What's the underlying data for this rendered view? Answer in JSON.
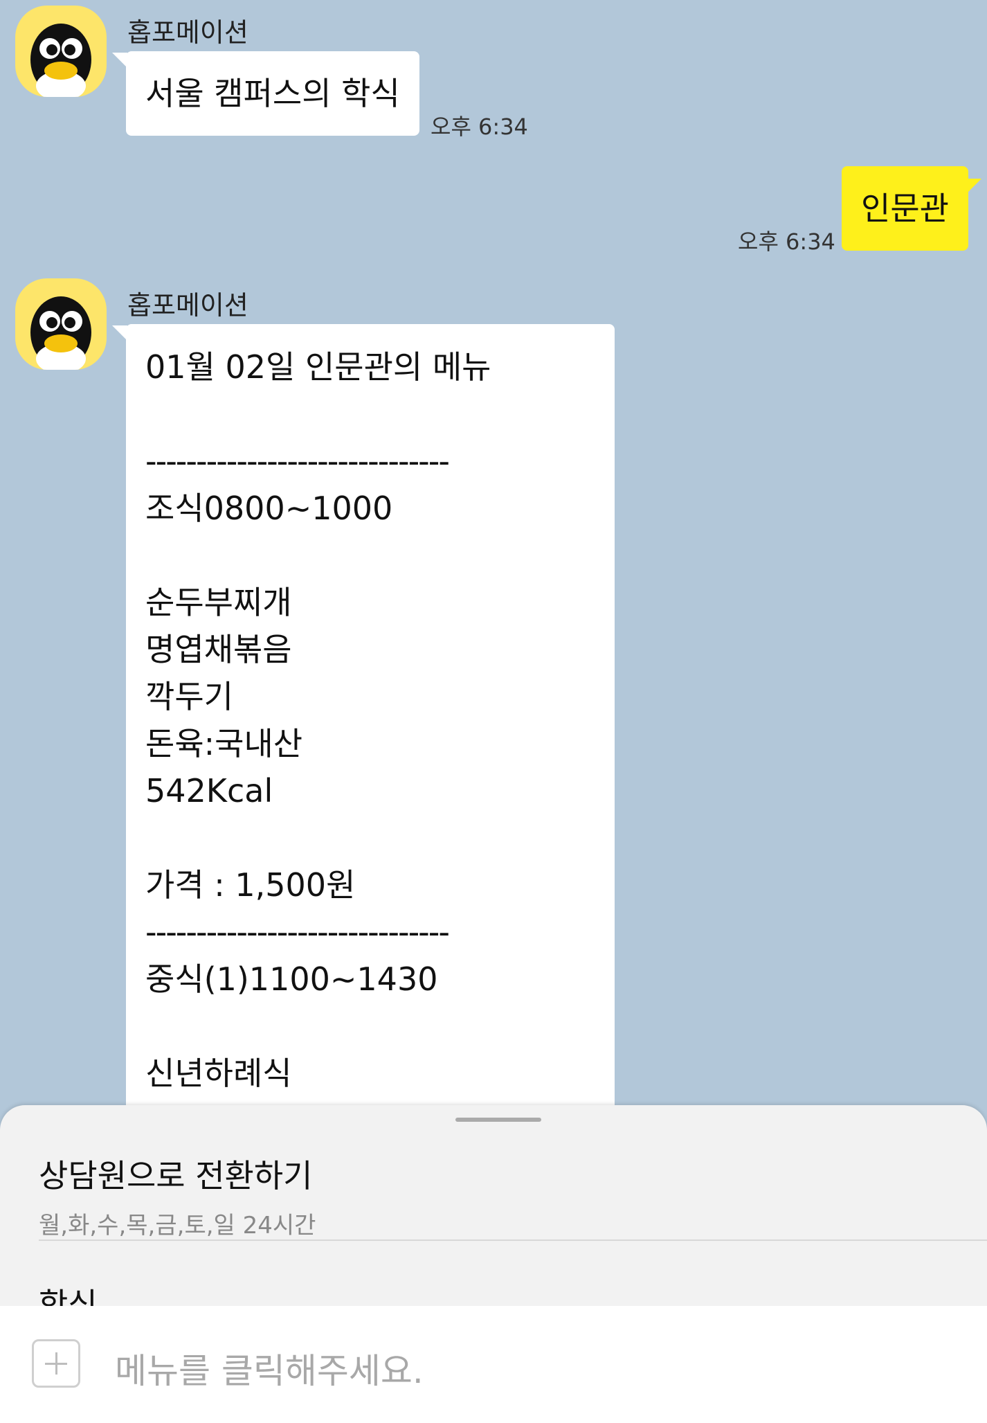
{
  "messages": [
    {
      "sender": "홉포메이션",
      "text": "서울 캠퍼스의 학식",
      "time": "오후 6:34"
    },
    {
      "sender": "me",
      "text": "인문관",
      "time": "오후 6:34"
    },
    {
      "sender": "홉포메이션",
      "time": "",
      "lines": [
        "01월 02일 인문관의 메뉴",
        "",
        "------------------------------",
        "조식0800~1000",
        "",
        "순두부찌개",
        "명엽채볶음",
        "깍두기",
        "돈육:국내산",
        "542Kcal",
        "",
        "가격 : 1,500원",
        "------------------------------",
        "중식(1)1100~1430",
        "",
        "신년하례식"
      ]
    }
  ],
  "sheet": {
    "title": "상담원으로 전환하기",
    "subtitle": "월,화,수,목,금,토,일 24시간",
    "next_item": "학식"
  },
  "input": {
    "placeholder": "메뉴를 클릭해주세요."
  },
  "colors": {
    "background": "#b2c7d9",
    "my_bubble": "#fef01b",
    "bot_bubble": "#ffffff",
    "avatar_bg": "#fde56a"
  },
  "icons": [
    "penguin-avatar-icon",
    "plus-icon"
  ]
}
